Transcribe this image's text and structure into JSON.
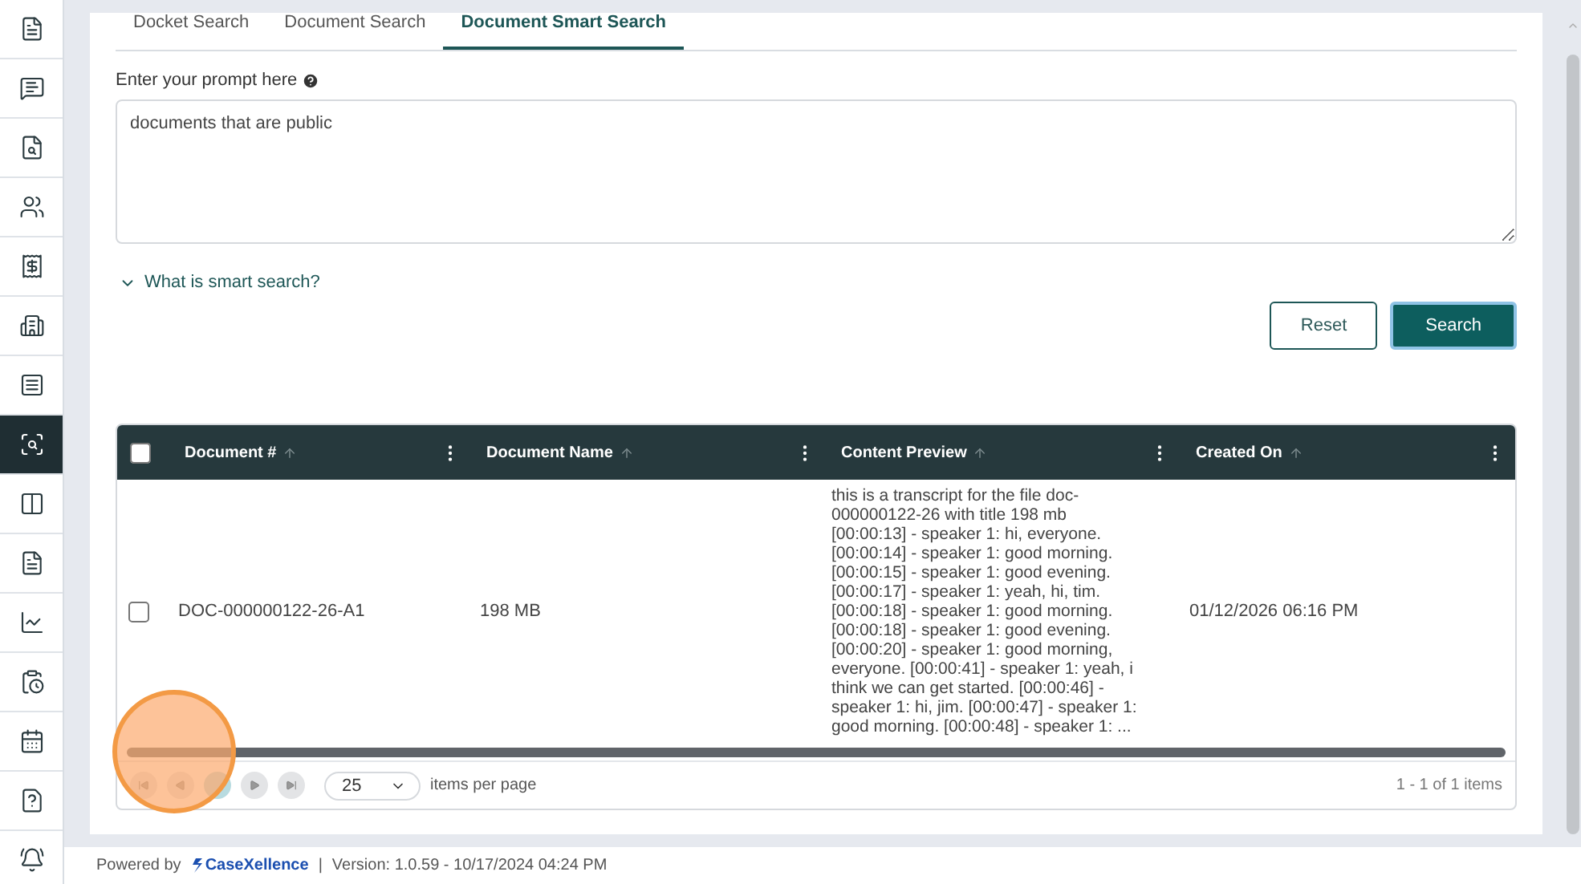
{
  "sidebar": {
    "items": [
      {
        "selected": false
      },
      {
        "selected": false
      },
      {
        "selected": false
      },
      {
        "selected": false
      },
      {
        "selected": false
      },
      {
        "selected": false
      },
      {
        "selected": false
      },
      {
        "selected": true
      },
      {
        "selected": false
      },
      {
        "selected": false
      },
      {
        "selected": false
      },
      {
        "selected": false
      },
      {
        "selected": false
      },
      {
        "selected": false
      },
      {
        "selected": false
      }
    ]
  },
  "tabs": [
    {
      "label": "Docket Search",
      "selected": false
    },
    {
      "label": "Document Search",
      "selected": false
    },
    {
      "label": "Document Smart Search",
      "selected": true
    }
  ],
  "prompt": {
    "label": "Enter your prompt here",
    "value": "documents that are public"
  },
  "help_link": {
    "label": "What is smart search?",
    "expanded": false
  },
  "buttons": [
    {
      "label": "Reset",
      "kind": "secondary"
    },
    {
      "label": "Search",
      "kind": "primary"
    }
  ],
  "table": {
    "select_all": {
      "checked": false
    },
    "columns": [
      "Document #",
      "Document Name",
      "Content Preview",
      "Created On"
    ],
    "rows": [
      {
        "checked": false,
        "cells": [
          "DOC-000000122-26-A1",
          "198 MB",
          "this is a transcript for the file doc-000000122-26 with title 198 mb [00:00:13] - speaker 1: hi, everyone. [00:00:14] - speaker 1: good morning. [00:00:15] - speaker 1: good evening. [00:00:17] - speaker 1: yeah, hi, tim. [00:00:18] - speaker 1: good morning. [00:00:18] - speaker 1: good evening. [00:00:20] - speaker 1: good morning, everyone. [00:00:41] - speaker 1: yeah, i think we can get started. [00:00:46] - speaker 1: hi, jim. [00:00:47] - speaker 1: good morning. [00:00:48] - speaker 1: ...",
          "01/12/2026 06:16 PM"
        ]
      }
    ]
  },
  "pager": {
    "page_size": "25",
    "page_size_label": "items per page",
    "summary": "1 - 1 of 1 items"
  },
  "footer": {
    "powered_by": "Powered by",
    "brand": "CaseXellence",
    "separator": "|",
    "version": "Version: 1.0.59 - 10/17/2024 04:24 PM"
  }
}
